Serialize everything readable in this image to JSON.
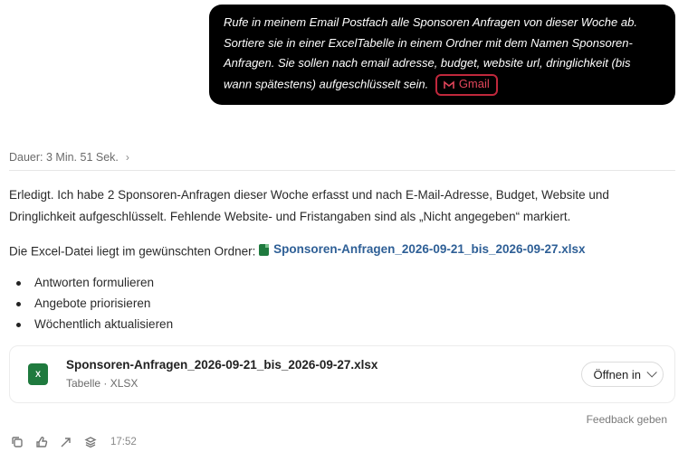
{
  "user_message": {
    "text": "Rufe in meinem Email Postfach alle Sponsoren Anfragen von dieser Woche ab. Sortiere sie in einer ExcelTabelle in einem Ordner mit dem Namen Sponsoren-Anfragen. Sie sollen nach email adresse, budget, website url, dringlichkeit (bis wann spätestens) aufgeschlüsselt sein.",
    "chip_label": "Gmail",
    "chip_icon": "gmail-icon"
  },
  "duration": {
    "label": "Dauer: 3 Min. 51 Sek.",
    "chevron": "›"
  },
  "answer": {
    "paragraph1": "Erledigt. Ich habe 2 Sponsoren-Anfragen dieser Woche erfasst und nach E-Mail-Adresse, Budget, Website und Dringlichkeit aufgeschlüsselt. Fehlende Website- und Fristangaben sind als „Nicht angegeben“ markiert.",
    "paragraph2_prefix": "Die Excel-Datei liegt im gewünschten Ordner: ",
    "file_link": "Sponsoren-Anfragen_2026-09-21_bis_2026-09-27.xlsx",
    "bullets": [
      "Antworten formulieren",
      "Angebote priorisieren",
      "Wöchentlich aktualisieren"
    ]
  },
  "file_card": {
    "name": "Sponsoren-Anfragen_2026-09-21_bis_2026-09-27.xlsx",
    "type": "Tabelle · XLSX",
    "icon_letter": "X",
    "open_button": "Öffnen in"
  },
  "feedback_label": "Feedback geben",
  "toolbar": {
    "time": "17:52"
  },
  "colors": {
    "bubble_bg": "#000000",
    "chip_accent": "#c0283c",
    "link": "#2e5f96",
    "excel_green": "#1f7a3e"
  }
}
